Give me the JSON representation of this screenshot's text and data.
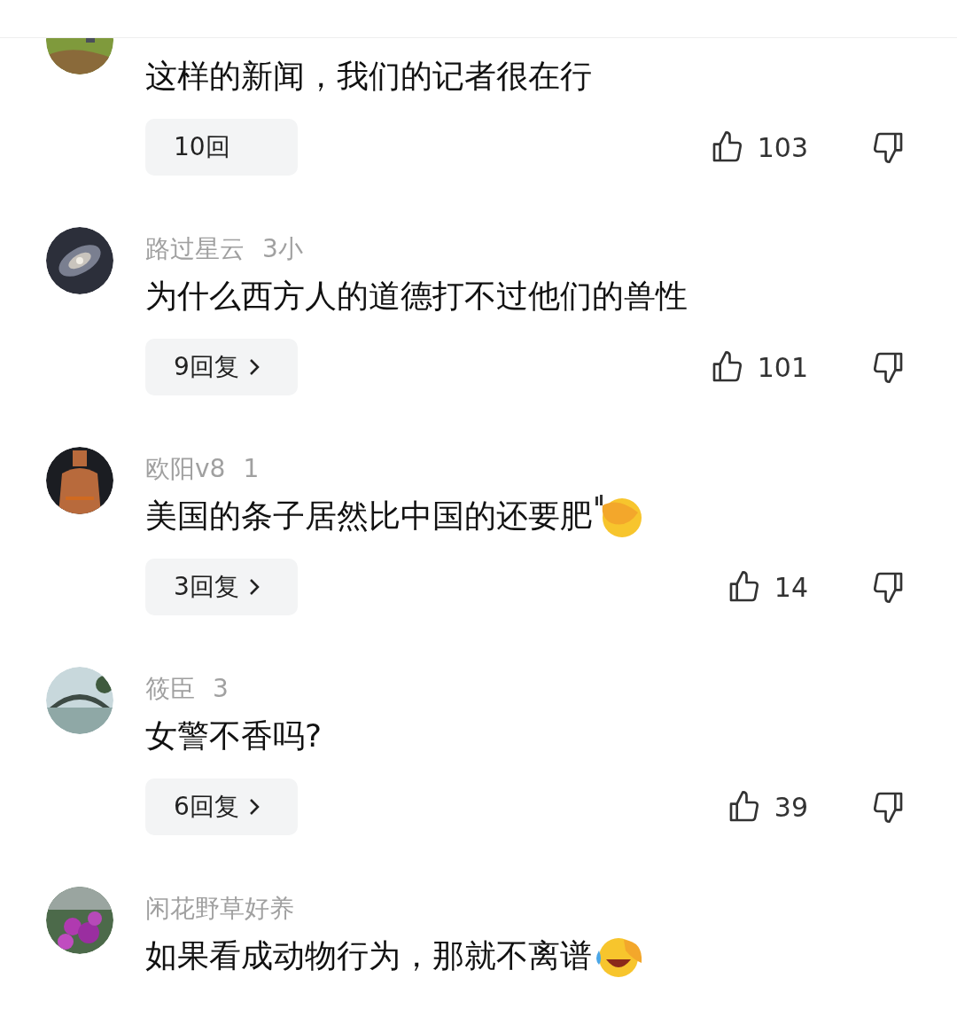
{
  "comments": [
    {
      "content": "这样的新闻，我们的记者很在行",
      "reply": "10回",
      "chevron": false,
      "likes": "103"
    },
    {
      "name": "路过星云",
      "time": "3小",
      "content": "为什么西方人的道德打不过他们的兽性",
      "reply": "9回复",
      "chevron": true,
      "likes": "101"
    },
    {
      "name": "欧阳v8",
      "time": "1",
      "content": "美国的条子居然比中国的还要肥",
      "emoji": {
        "kind": "face-palm"
      },
      "reply": "3回复",
      "chevron": true,
      "likes": "14"
    },
    {
      "name": "筱臣",
      "time": "3",
      "content": "女警不香吗?",
      "reply": "6回复",
      "chevron": true,
      "likes": "39"
    },
    {
      "name": "闲花野草好养",
      "content": "如果看成动物行为，那就不离谱",
      "emoji": {
        "kind": "laugh-cry"
      }
    }
  ]
}
